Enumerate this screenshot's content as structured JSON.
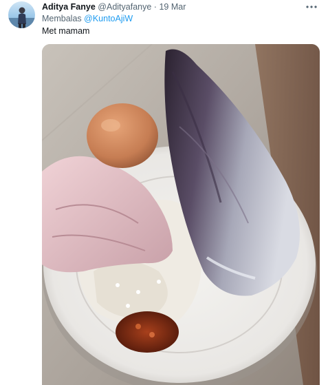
{
  "tweet": {
    "author_name": "Aditya Fanye",
    "author_handle": "@Adityafanye",
    "separator": "·",
    "timestamp": "19 Mar",
    "reply_prefix": "Membalas",
    "reply_to": "@KuntoAjiW",
    "text": "Met mamam",
    "icons": {
      "avatar": "profile-photo",
      "more": "more-dots-icon"
    },
    "colors": {
      "link": "#1d9bf0",
      "secondary_text": "#536471",
      "primary_text": "#0f1419"
    }
  }
}
